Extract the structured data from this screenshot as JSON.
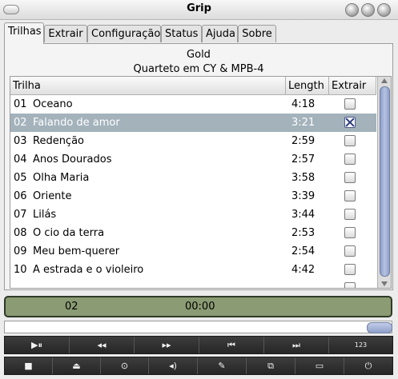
{
  "window": {
    "title": "Grip"
  },
  "tabs": [
    {
      "label": "Trilhas"
    },
    {
      "label": "Extrair"
    },
    {
      "label": "Configuração"
    },
    {
      "label": "Status"
    },
    {
      "label": "Ajuda"
    },
    {
      "label": "Sobre"
    }
  ],
  "disc": {
    "artist": "Gold",
    "title": "Quarteto em CY & MPB-4"
  },
  "columns": {
    "track": "Trilha",
    "length": "Length",
    "extract": "Extrair"
  },
  "tracks": [
    {
      "num": "01",
      "name": "Oceano",
      "length": "4:18",
      "extract": false
    },
    {
      "num": "02",
      "name": "Falando de amor",
      "length": "3:21",
      "extract": true,
      "selected": true
    },
    {
      "num": "03",
      "name": "Redenção",
      "length": "2:59",
      "extract": false
    },
    {
      "num": "04",
      "name": "Anos Dourados",
      "length": "2:57",
      "extract": false
    },
    {
      "num": "05",
      "name": "Olha Maria",
      "length": "3:58",
      "extract": false
    },
    {
      "num": "06",
      "name": "Oriente",
      "length": "3:39",
      "extract": false
    },
    {
      "num": "07",
      "name": "Lilás",
      "length": "3:44",
      "extract": false
    },
    {
      "num": "08",
      "name": "O cio da terra",
      "length": "2:53",
      "extract": false
    },
    {
      "num": "09",
      "name": "Meu bem-querer",
      "length": "2:54",
      "extract": false
    },
    {
      "num": "10",
      "name": "A estrada e o violeiro",
      "length": "4:42",
      "extract": false
    }
  ],
  "display": {
    "track": "02",
    "time": "00:00"
  },
  "controls_row1": [
    {
      "label": "▶⏸",
      "icon": "play-pause-icon"
    },
    {
      "label": "◂◂",
      "icon": "rewind-icon"
    },
    {
      "label": "▸▸",
      "icon": "fast-forward-icon"
    },
    {
      "label": "⏮",
      "icon": "previous-track-icon"
    },
    {
      "label": "⏭",
      "icon": "next-track-icon"
    },
    {
      "label": "123",
      "icon": "track-order-icon"
    }
  ],
  "controls_row2": [
    {
      "label": "■",
      "icon": "stop-icon"
    },
    {
      "label": "⏏",
      "icon": "eject-icon"
    },
    {
      "label": "⊙",
      "icon": "disc-icon"
    },
    {
      "label": "◂)",
      "icon": "volume-icon"
    },
    {
      "label": "✎",
      "icon": "edit-icon"
    },
    {
      "label": "⧉",
      "icon": "network-icon"
    },
    {
      "label": "▭",
      "icon": "window-icon"
    },
    {
      "label": "⏻",
      "icon": "power-icon"
    }
  ],
  "colors": {
    "selection": "#a3b2bb",
    "display_bg": "#8b9b73",
    "scroll_thumb": "#8e9ec8"
  }
}
